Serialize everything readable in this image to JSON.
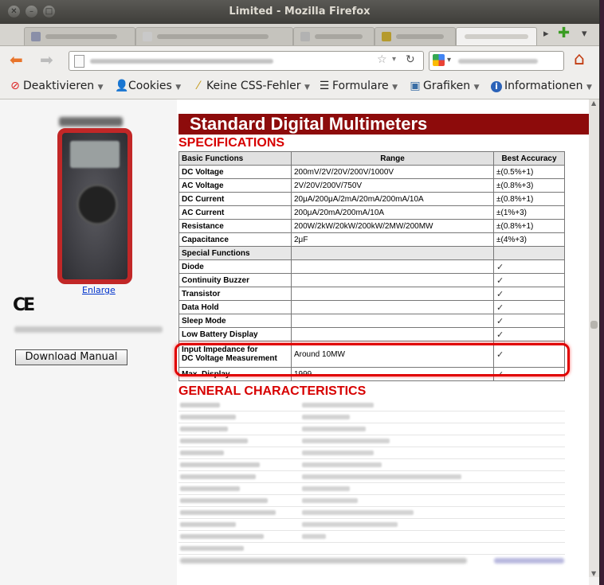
{
  "window": {
    "title": "Limited - Mozilla Firefox"
  },
  "toolbar": {
    "items": [
      {
        "label": "Deaktivieren",
        "icon": "no-entry-icon"
      },
      {
        "label": "Cookies",
        "icon": "person-icon"
      },
      {
        "label": "Keine CSS-Fehler",
        "icon": "magic-wand-icon"
      },
      {
        "label": "Formulare",
        "icon": "form-icon"
      },
      {
        "label": "Grafiken",
        "icon": "image-icon"
      },
      {
        "label": "Informationen",
        "icon": "info-icon"
      }
    ]
  },
  "page": {
    "banner": "Standard Digital Multimeters",
    "enlarge_link": "Enlarge",
    "ce_mark": "CE",
    "download_button": "Download Manual",
    "specifications_heading": "SPECIFICATIONS",
    "general_heading": "GENERAL CHARACTERISTICS",
    "table": {
      "headers": [
        "Basic Functions",
        "Range",
        "Best Accuracy"
      ],
      "basic_rows": [
        [
          "DC Voltage",
          "200mV/2V/20V/200V/1000V",
          "±(0.5%+1)"
        ],
        [
          "AC Voltage",
          "2V/20V/200V/750V",
          "±(0.8%+3)"
        ],
        [
          "DC Current",
          "20μA/200μA/2mA/20mA/200mA/10A",
          "±(0.8%+1)"
        ],
        [
          "AC Current",
          "200μA/20mA/200mA/10A",
          "±(1%+3)"
        ],
        [
          "Resistance",
          "200W/2kW/20kW/200kW/2MW/200MW",
          "±(0.8%+1)"
        ],
        [
          "Capacitance",
          "2μF",
          "±(4%+3)"
        ]
      ],
      "special_heading": "Special Functions",
      "special_rows": [
        [
          "Diode",
          "",
          "✓"
        ],
        [
          "Continuity Buzzer",
          "",
          "✓"
        ],
        [
          "Transistor",
          "",
          "✓"
        ],
        [
          "Data Hold",
          "",
          "✓"
        ],
        [
          "Sleep Mode",
          "",
          "✓"
        ],
        [
          "Low Battery Display",
          "",
          "✓"
        ]
      ],
      "impedance_row": {
        "line1": "Input Impedance for",
        "line2": "DC Voltage Measurement",
        "range": "Around 10MW",
        "accuracy": "✓"
      },
      "max_display_row": [
        "Max. Display",
        "1999",
        "✓"
      ]
    }
  }
}
